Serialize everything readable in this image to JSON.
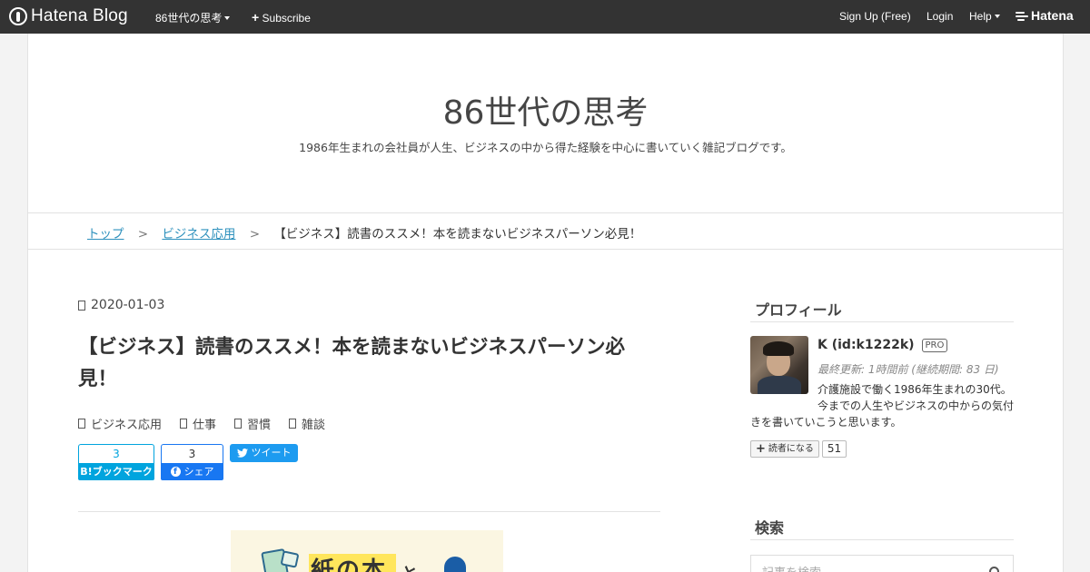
{
  "topbar": {
    "logo_text": "Hatena Blog",
    "blog_menu": "86世代の思考",
    "subscribe": "Subscribe",
    "signup": "Sign Up (Free)",
    "login": "Login",
    "help": "Help",
    "brand": "Hatena",
    "bg_color": "#333333"
  },
  "blog": {
    "title": "86世代の思考",
    "description": "1986年生まれの会社員が人生、ビジネスの中から得た経験を中心に書いていく雑記ブログです。"
  },
  "breadcrumb": {
    "home": "トップ",
    "category": "ビジネス応用",
    "separator": ">",
    "current": "【ビジネス】読書のススメ！本を読まないビジネスパーソン必見！"
  },
  "entry": {
    "date": "2020-01-03",
    "title": "【ビジネス】読書のススメ！本を読まないビジネスパーソン必見！",
    "categories": [
      "ビジネス応用",
      "仕事",
      "習慣",
      "雑談"
    ],
    "share": {
      "hatena_count": "3",
      "hatena_label": "B!ブックマーク",
      "facebook_count": "3",
      "facebook_label": "シェア",
      "tweet_label": "ツイート"
    },
    "thumbnail": {
      "title": "紙の本",
      "after": "と"
    }
  },
  "sidebar": {
    "profile_heading": "プロフィール",
    "name": "K (id:k1222k)",
    "pro_badge": "PRO",
    "meta": "最終更新: 1時間前 (継続期間: 83 日)",
    "desc_line1": "介護施設で働く1986年生まれの30代。",
    "desc_line2": "今までの人生やビジネスの中からの気付きを書いていこうと思います。",
    "reader_button": "読者になる",
    "reader_count": "51",
    "search_heading": "検索",
    "search_placeholder": "記事を検索"
  },
  "colors": {
    "accent_link": "#2e91bd",
    "hatena_blue": "#00a4de",
    "facebook_blue": "#1877f2",
    "twitter_blue": "#1d9bf0"
  }
}
